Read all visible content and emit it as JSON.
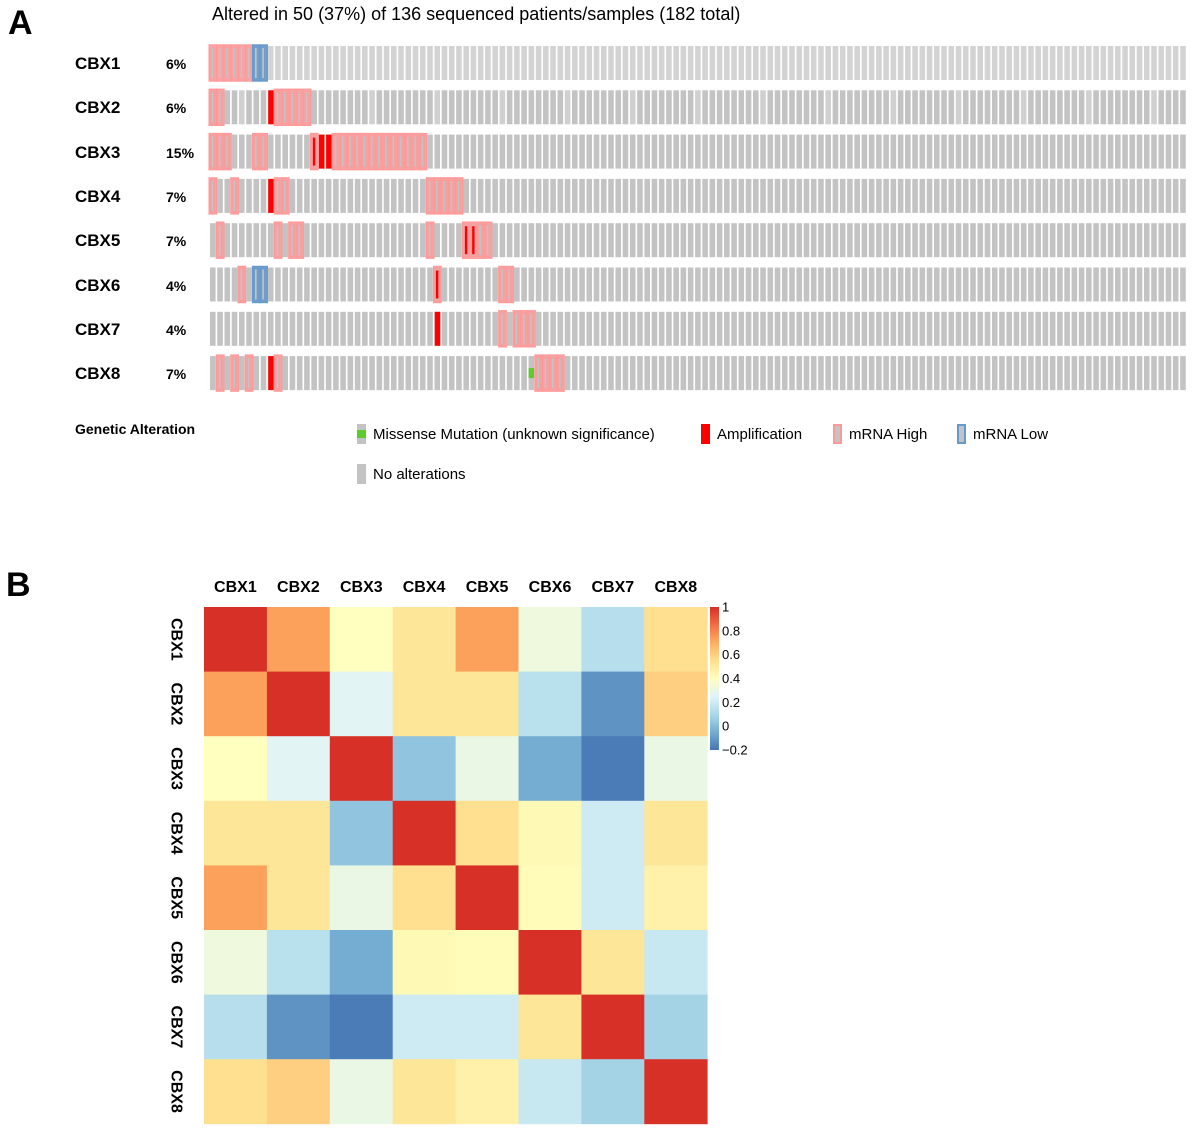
{
  "panels": {
    "a_label": "A",
    "b_label": "B"
  },
  "chart_data": [
    {
      "type": "oncoprint",
      "title": "Altered in 50 (37%) of 136 sequenced patients/samples (182 total)",
      "n_samples": 136,
      "colors": {
        "no_alteration": "#c3c3c3",
        "no_alteration_light": "#d0d0d0",
        "mrna_high": "#ff9999",
        "mrna_low": "#6699cc",
        "amplification": "#ff0000",
        "missense": "#5dcb2e"
      },
      "genes": [
        {
          "name": "CBX1",
          "pct": "6%",
          "mrna_high": [
            0,
            1,
            2,
            3,
            4,
            5
          ],
          "mrna_low": [
            6,
            7
          ],
          "amp": [],
          "missense": []
        },
        {
          "name": "CBX2",
          "pct": "6%",
          "mrna_high": [
            0,
            1,
            9,
            10,
            11,
            12,
            13
          ],
          "mrna_low": [],
          "amp": [
            8
          ],
          "missense": []
        },
        {
          "name": "CBX3",
          "pct": "15%",
          "mrna_high": [
            0,
            1,
            2,
            6,
            7,
            14,
            17,
            18,
            19,
            20,
            21,
            22,
            23,
            24,
            25,
            26,
            27,
            28,
            29
          ],
          "mrna_low": [],
          "amp": [
            14,
            15,
            16
          ],
          "missense": []
        },
        {
          "name": "CBX4",
          "pct": "7%",
          "mrna_high": [
            0,
            3,
            9,
            10,
            30,
            31,
            32,
            33,
            34
          ],
          "mrna_low": [],
          "amp": [
            8
          ],
          "missense": []
        },
        {
          "name": "CBX5",
          "pct": "7%",
          "mrna_high": [
            1,
            9,
            11,
            12,
            30,
            35,
            36,
            37,
            38
          ],
          "mrna_low": [],
          "amp": [
            35,
            36
          ],
          "missense": []
        },
        {
          "name": "CBX6",
          "pct": "4%",
          "mrna_high": [
            4,
            31,
            40,
            41
          ],
          "mrna_low": [
            6,
            7
          ],
          "amp": [
            31
          ],
          "missense": []
        },
        {
          "name": "CBX7",
          "pct": "4%",
          "mrna_high": [
            40,
            42,
            43,
            44
          ],
          "mrna_low": [],
          "amp": [
            31
          ],
          "missense": []
        },
        {
          "name": "CBX8",
          "pct": "7%",
          "mrna_high": [
            1,
            3,
            5,
            9,
            45,
            46,
            47,
            48
          ],
          "mrna_low": [],
          "amp": [
            8
          ],
          "missense": [
            44
          ]
        }
      ],
      "legend": {
        "title": "Genetic Alteration",
        "items": [
          {
            "key": "missense",
            "label": "Missense Mutation (unknown significance)"
          },
          {
            "key": "amplification",
            "label": "Amplification"
          },
          {
            "key": "mrna_high",
            "label": "mRNA High"
          },
          {
            "key": "mrna_low",
            "label": "mRNA Low"
          },
          {
            "key": "no_alteration",
            "label": "No alterations"
          }
        ]
      }
    },
    {
      "type": "heatmap",
      "title": "",
      "x_labels": [
        "CBX1",
        "CBX2",
        "CBX3",
        "CBX4",
        "CBX5",
        "CBX6",
        "CBX7",
        "CBX8"
      ],
      "y_labels": [
        "CBX1",
        "CBX2",
        "CBX3",
        "CBX4",
        "CBX5",
        "CBX6",
        "CBX7",
        "CBX8"
      ],
      "values": [
        [
          1.0,
          0.73,
          0.4,
          0.52,
          0.73,
          0.32,
          0.13,
          0.55
        ],
        [
          0.73,
          1.0,
          0.26,
          0.52,
          0.52,
          0.14,
          -0.12,
          0.6
        ],
        [
          0.4,
          0.26,
          1.0,
          0.03,
          0.3,
          -0.05,
          -0.18,
          0.3
        ],
        [
          0.52,
          0.52,
          0.03,
          1.0,
          0.55,
          0.43,
          0.2,
          0.52
        ],
        [
          0.73,
          0.52,
          0.3,
          0.55,
          1.0,
          0.42,
          0.2,
          0.47
        ],
        [
          0.32,
          0.14,
          -0.05,
          0.43,
          0.42,
          1.0,
          0.52,
          0.18
        ],
        [
          0.13,
          -0.12,
          -0.18,
          0.2,
          0.2,
          0.52,
          1.0,
          0.08
        ],
        [
          0.55,
          0.6,
          0.3,
          0.52,
          0.47,
          0.18,
          0.08,
          1.0
        ]
      ],
      "colorbar": {
        "range": [
          -0.2,
          1.0
        ],
        "ticks": [
          1,
          0.8,
          0.6,
          0.4,
          0.2,
          0,
          -0.2
        ],
        "tick_labels": [
          "1",
          "0.8",
          "0.6",
          "0.4",
          "0.2",
          "0",
          "−0.2"
        ],
        "palette": [
          "#4575b4",
          "#74add1",
          "#abd9e9",
          "#e0f3f8",
          "#ffffbf",
          "#fee090",
          "#fdae61",
          "#f46d43",
          "#d73027"
        ]
      }
    }
  ]
}
